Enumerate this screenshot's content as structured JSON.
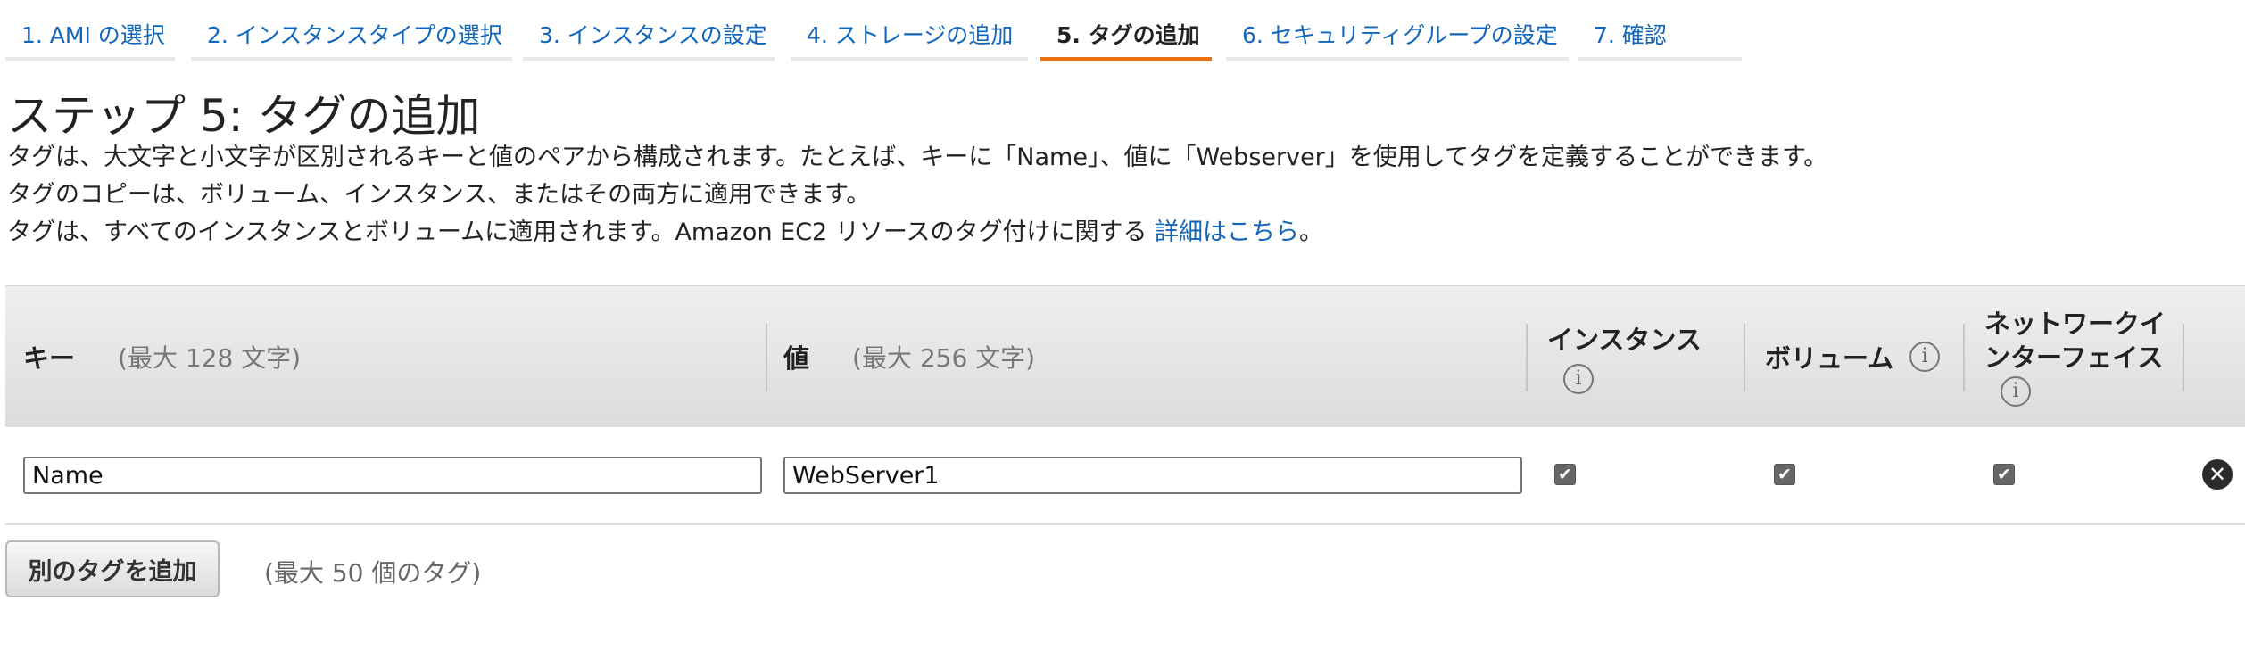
{
  "wizard": {
    "steps": [
      {
        "label": "1. AMI の選択",
        "active": false
      },
      {
        "label": "2. インスタンスタイプの選択",
        "active": false
      },
      {
        "label": "3. インスタンスの設定",
        "active": false
      },
      {
        "label": "4. ストレージの追加",
        "active": false
      },
      {
        "label": "5. タグの追加",
        "active": true
      },
      {
        "label": "6. セキュリティグループの設定",
        "active": false
      },
      {
        "label": "7. 確認",
        "active": false
      }
    ]
  },
  "page": {
    "title": "ステップ 5: タグの追加",
    "desc_line1": "タグは、大文字と小文字が区別されるキーと値のペアから構成されます。たとえば、キーに「Name」、値に「Webserver」を使用してタグを定義することができます。",
    "desc_line2": "タグのコピーは、ボリューム、インスタンス、またはその両方に適用できます。",
    "desc_line3": "タグは、すべてのインスタンスとボリュームに適用されます。Amazon EC2 リソースのタグ付けに関する ",
    "desc_link": "詳細はこちら",
    "desc_end": "。"
  },
  "table": {
    "headers": {
      "key": "キー",
      "key_hint": "(最大 128 文字)",
      "value": "値",
      "value_hint": "(最大 256 文字)",
      "instance": "インスタンス",
      "volume": "ボリューム",
      "eni_line1": "ネットワークイ",
      "eni_line2": "ンターフェイス",
      "info_glyph": "i"
    },
    "rows": [
      {
        "key": "Name",
        "value": "WebServer1",
        "instance": true,
        "volume": true,
        "network_interface": true,
        "check_glyph": "✔",
        "remove_glyph": "✕"
      }
    ]
  },
  "actions": {
    "add_tag_label": "別のタグを追加",
    "add_tag_hint": "(最大 50 個のタグ)"
  },
  "colors": {
    "link": "#1166bb",
    "active_step_underline": "#ec7211"
  }
}
